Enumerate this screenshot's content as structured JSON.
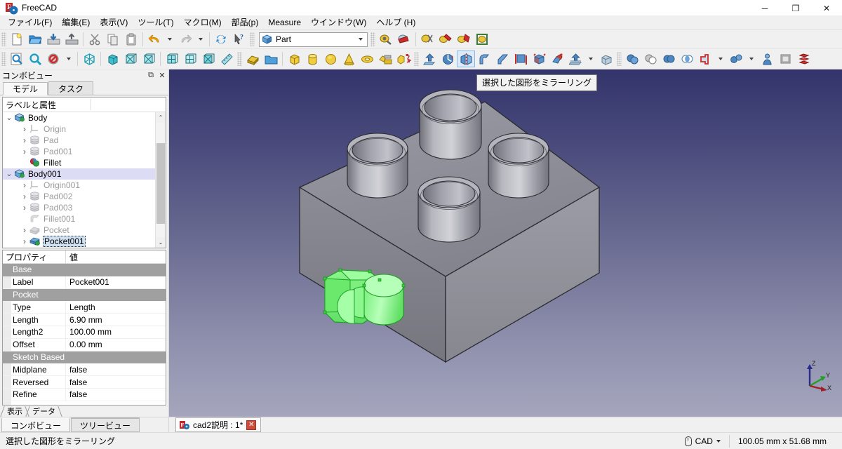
{
  "window": {
    "title": "FreeCAD",
    "minimize": "─",
    "maximize": "❐",
    "close": "✕"
  },
  "menu": [
    {
      "label": "ファイル(F)"
    },
    {
      "label": "編集(E)"
    },
    {
      "label": "表示(V)"
    },
    {
      "label": "ツール(T)"
    },
    {
      "label": "マクロ(M)"
    },
    {
      "label": "部品(p)"
    },
    {
      "label": "Measure"
    },
    {
      "label": "ウインドウ(W)"
    },
    {
      "label": "ヘルプ (H)"
    }
  ],
  "workbench": {
    "selected": "Part"
  },
  "toolbar_row1": [
    {
      "name": "new-document-button"
    },
    {
      "name": "open-document-button"
    },
    {
      "name": "save-document-button"
    },
    {
      "name": "save-as-document-button"
    },
    {
      "name": "cut-button"
    },
    {
      "name": "copy-button"
    },
    {
      "name": "paste-button"
    },
    {
      "name": "undo-button"
    },
    {
      "name": "undo-dropdown-button"
    },
    {
      "name": "redo-button"
    },
    {
      "name": "redo-dropdown-button"
    },
    {
      "name": "refresh-button"
    },
    {
      "name": "whats-this-button"
    },
    {
      "name": "macro-record-button"
    },
    {
      "name": "macro-stop-button"
    },
    {
      "name": "macro-execute-button"
    },
    {
      "name": "macro-edit-button"
    },
    {
      "name": "macro-debug-button"
    },
    {
      "name": "macro-attach-button"
    }
  ],
  "toolbar_row2": [
    {
      "name": "fit-all-button"
    },
    {
      "name": "fit-selection-button"
    },
    {
      "name": "draw-style-button"
    },
    {
      "name": "isometric-view-button"
    },
    {
      "name": "axonometric-view-button"
    },
    {
      "name": "front-view-button"
    },
    {
      "name": "top-view-button"
    },
    {
      "name": "right-view-button"
    },
    {
      "name": "rear-view-button"
    },
    {
      "name": "bottom-view-button"
    },
    {
      "name": "measure-button"
    },
    {
      "name": "boolean-button"
    },
    {
      "name": "create-group-button"
    },
    {
      "name": "box-primitive-button"
    },
    {
      "name": "cylinder-primitive-button"
    },
    {
      "name": "sphere-primitive-button"
    },
    {
      "name": "cone-primitive-button"
    },
    {
      "name": "torus-primitive-button"
    },
    {
      "name": "primitives-button"
    },
    {
      "name": "shape-builder-button"
    },
    {
      "name": "extrude-button"
    },
    {
      "name": "revolve-button"
    },
    {
      "name": "mirror-button"
    },
    {
      "name": "fillet-button"
    },
    {
      "name": "chamfer-button"
    },
    {
      "name": "ruled-surface-button"
    },
    {
      "name": "loft-button"
    },
    {
      "name": "sweep-button"
    },
    {
      "name": "offset-button"
    },
    {
      "name": "offset-dropdown-button"
    },
    {
      "name": "thickness-button"
    },
    {
      "name": "boolean-op-button"
    },
    {
      "name": "cut-op-button"
    },
    {
      "name": "union-op-button"
    },
    {
      "name": "intersection-op-button"
    },
    {
      "name": "join-button"
    },
    {
      "name": "join-dropdown-button"
    },
    {
      "name": "split-button"
    },
    {
      "name": "split-dropdown-button"
    },
    {
      "name": "compound-button"
    },
    {
      "name": "check-geometry-button"
    },
    {
      "name": "cross-sections-button"
    }
  ],
  "combo_view": {
    "title": "コンボビュー",
    "float_icon": "⧉",
    "close_icon": "✕",
    "tabs": [
      {
        "label": "モデル",
        "selected": true
      },
      {
        "label": "タスク",
        "selected": false
      }
    ],
    "tree_header": "ラベルと属性",
    "tree": [
      {
        "label": "Body",
        "indent": 1,
        "expander": "v",
        "icon": "body-icon",
        "dim": false,
        "selected": false,
        "focused": false
      },
      {
        "label": "Origin",
        "indent": 2,
        "expander": ">",
        "icon": "origin-icon",
        "dim": true,
        "selected": false,
        "focused": false
      },
      {
        "label": "Pad",
        "indent": 2,
        "expander": ">",
        "icon": "pad-icon",
        "dim": true,
        "selected": false,
        "focused": false
      },
      {
        "label": "Pad001",
        "indent": 2,
        "expander": ">",
        "icon": "pad-icon",
        "dim": true,
        "selected": false,
        "focused": false
      },
      {
        "label": "Fillet",
        "indent": 2,
        "expander": "",
        "icon": "fillet-icon",
        "dim": false,
        "selected": false,
        "focused": false
      },
      {
        "label": "Body001",
        "indent": 1,
        "expander": "v",
        "icon": "body-icon",
        "dim": false,
        "selected": true,
        "focused": false
      },
      {
        "label": "Origin001",
        "indent": 2,
        "expander": ">",
        "icon": "origin-icon",
        "dim": true,
        "selected": false,
        "focused": false
      },
      {
        "label": "Pad002",
        "indent": 2,
        "expander": ">",
        "icon": "pad-icon",
        "dim": true,
        "selected": false,
        "focused": false
      },
      {
        "label": "Pad003",
        "indent": 2,
        "expander": ">",
        "icon": "pad-icon",
        "dim": true,
        "selected": false,
        "focused": false
      },
      {
        "label": "Fillet001",
        "indent": 2,
        "expander": "",
        "icon": "fillet-gray-icon",
        "dim": true,
        "selected": false,
        "focused": false
      },
      {
        "label": "Pocket",
        "indent": 2,
        "expander": ">",
        "icon": "pocket-icon",
        "dim": true,
        "selected": false,
        "focused": false
      },
      {
        "label": "Pocket001",
        "indent": 2,
        "expander": ">",
        "icon": "pocket-active-icon",
        "dim": false,
        "selected": false,
        "focused": true
      }
    ],
    "scroll_up": "⌃",
    "scroll_down": "⌄"
  },
  "properties": {
    "header": {
      "name": "プロパティ",
      "value": "値"
    },
    "rows": [
      {
        "type": "group",
        "name": "Base",
        "value": ""
      },
      {
        "type": "item",
        "name": "Label",
        "value": "Pocket001"
      },
      {
        "type": "group",
        "name": "Pocket",
        "value": ""
      },
      {
        "type": "item",
        "name": "Type",
        "value": "Length"
      },
      {
        "type": "item",
        "name": "Length",
        "value": "6.90 mm"
      },
      {
        "type": "item",
        "name": "Length2",
        "value": "100.00 mm"
      },
      {
        "type": "item",
        "name": "Offset",
        "value": "0.00 mm"
      },
      {
        "type": "group",
        "name": "Sketch Based",
        "value": ""
      },
      {
        "type": "item",
        "name": "Midplane",
        "value": "false"
      },
      {
        "type": "item",
        "name": "Reversed",
        "value": "false"
      },
      {
        "type": "item",
        "name": "Refine",
        "value": "false"
      }
    ],
    "view_data_tabs": [
      {
        "label": "表示",
        "selected": false
      },
      {
        "label": "データ",
        "selected": true
      }
    ]
  },
  "panel_bottom_tabs": [
    {
      "label": "コンボビュー",
      "selected": true
    },
    {
      "label": "ツリービュー",
      "selected": false
    }
  ],
  "viewport": {
    "tooltip": "選択した図形をミラーリング",
    "axis_labels": {
      "x": "X",
      "y": "Y",
      "z": "Z"
    }
  },
  "document_tab": {
    "label": "cad2説明 : 1*",
    "close": "✕"
  },
  "statusbar": {
    "message": "選択した図形をミラーリング",
    "nav_style": "CAD",
    "nav_caret": "▾",
    "dimensions": "100.05 mm x 51.68 mm"
  },
  "colors": {
    "accent": "#3366cc",
    "selection": "#dcdcf5",
    "highlight_green": "#7cf07c",
    "model_gray": "#8c8c94",
    "bg_top": "#33346b",
    "bg_bottom": "#a5a6bd"
  }
}
